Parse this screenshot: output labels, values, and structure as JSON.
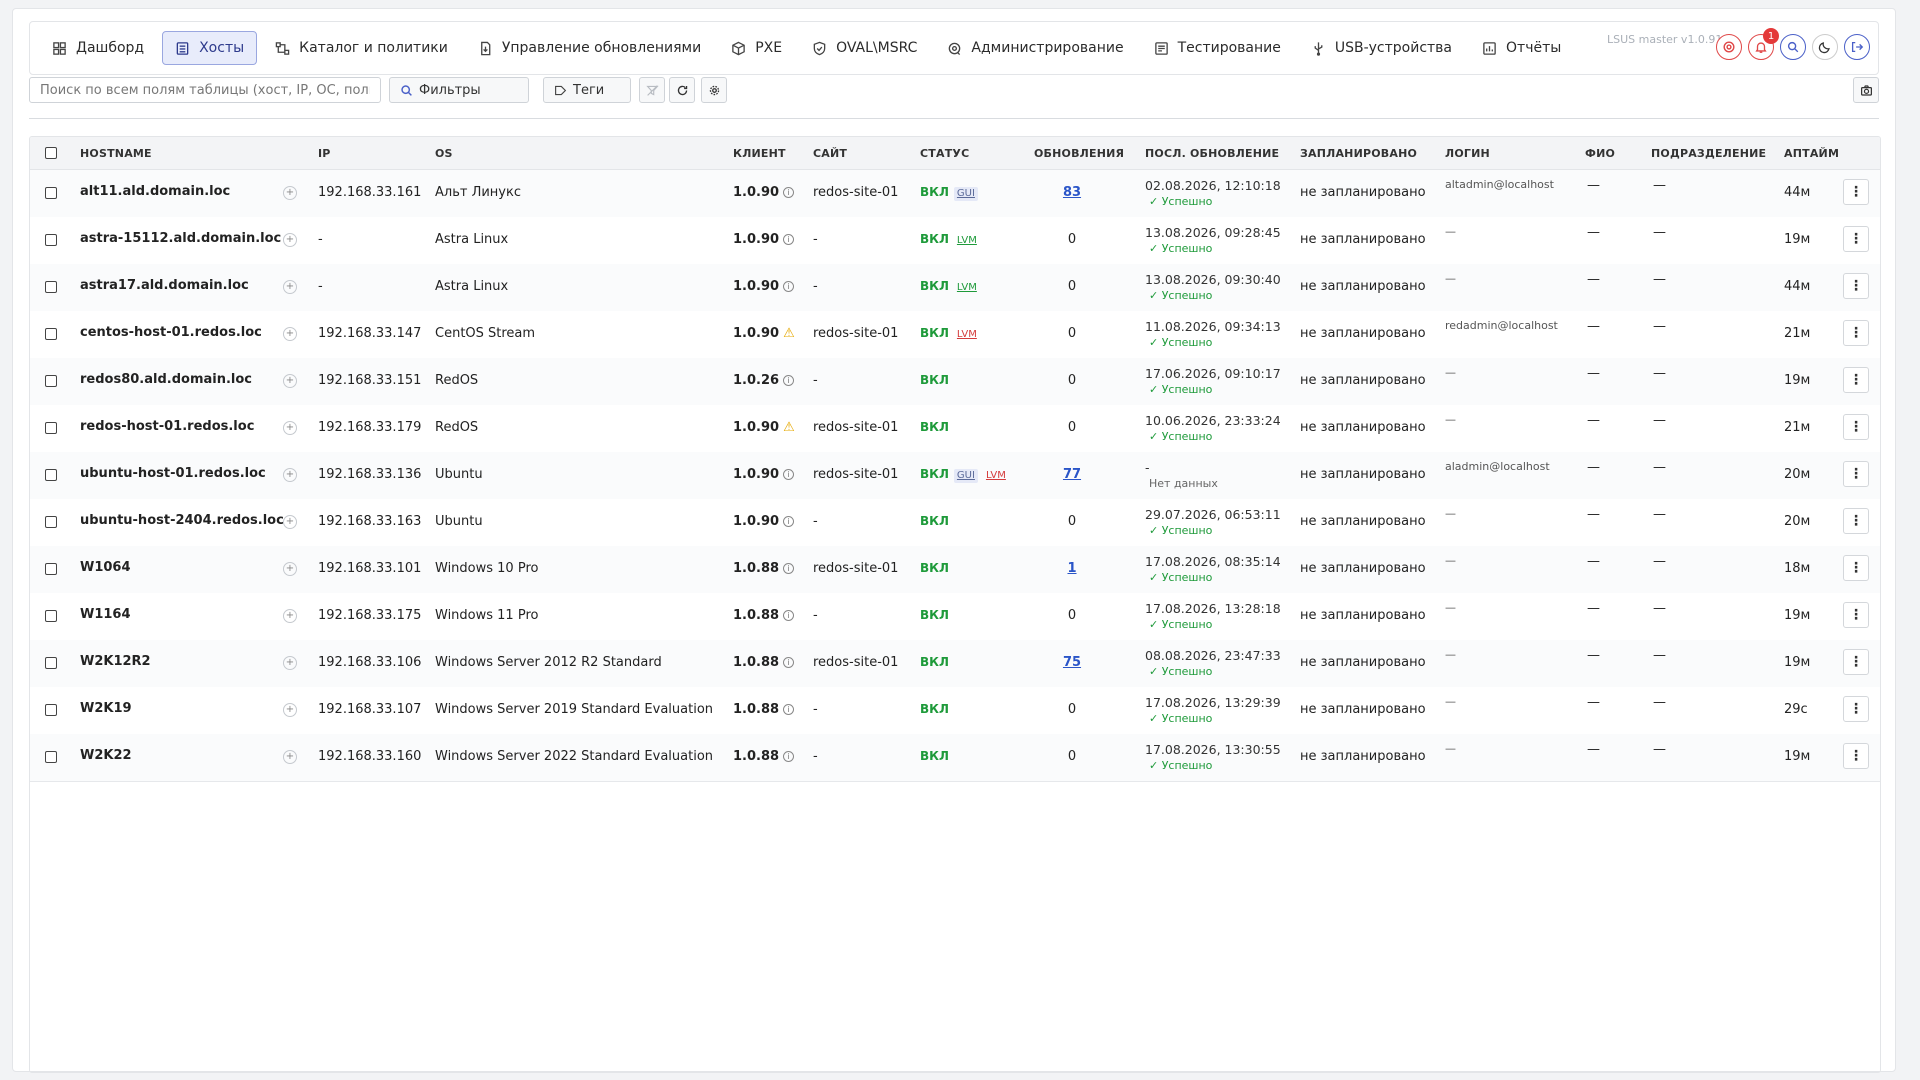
{
  "nav": {
    "items": [
      {
        "label": "Дашборд",
        "icon": "dashboard-icon",
        "active": false
      },
      {
        "label": "Хосты",
        "icon": "server-icon",
        "active": true
      },
      {
        "label": "Каталог и политики",
        "icon": "hierarchy-icon",
        "active": false
      },
      {
        "label": "Управление обновлениями",
        "icon": "file-update-icon",
        "active": false
      },
      {
        "label": "PXE",
        "icon": "cube-icon",
        "active": false
      },
      {
        "label": "OVAL\\MSRC",
        "icon": "shield-icon",
        "active": false
      },
      {
        "label": "Администрирование",
        "icon": "settings-icon",
        "active": false
      },
      {
        "label": "Тестирование",
        "icon": "checklist-icon",
        "active": false
      },
      {
        "label": "USB-устройства",
        "icon": "usb-icon",
        "active": false
      },
      {
        "label": "Отчёты",
        "icon": "report-icon",
        "active": false
      }
    ],
    "version": "LSUS master v1.0.91",
    "notifications_count": "1"
  },
  "toolbar": {
    "search_placeholder": "Поиск по всем полям таблицы (хост, IP, ОС, политика,",
    "filters_label": "Фильтры",
    "tags_label": "Теги"
  },
  "table": {
    "headers": {
      "hostname": "HOSTNAME",
      "ip": "IP",
      "os": "OS",
      "client": "КЛИЕНТ",
      "site": "САЙТ",
      "status": "СТАТУС",
      "updates": "ОБНОВЛЕНИЯ",
      "last_update": "ПОСЛ. ОБНОВЛЕНИЕ",
      "scheduled": "ЗАПЛАНИРОВАНО",
      "login": "ЛОГИН",
      "fio": "ФИО",
      "department": "ПОДРАЗДЕЛЕНИЕ",
      "uptime": "АПТАЙМ"
    },
    "rows": [
      {
        "host": "alt11.ald.domain.loc",
        "ip": "192.168.33.161",
        "os": "Альт Линукс",
        "client": "1.0.90",
        "client_icon": "info",
        "site": "redos-site-01",
        "status": "ВКЛ",
        "tags": [
          {
            "t": "GUI",
            "k": "gui"
          }
        ],
        "updates": "83",
        "updates_link": true,
        "date": "02.08.2026, 12:10:18",
        "result": "✓ Успешно",
        "scheduled": "не запланировано",
        "login": "altadmin@localhost",
        "fio": "—",
        "dept": "—",
        "uptime": "44м"
      },
      {
        "host": "astra-15112.ald.domain.loc",
        "ip": "-",
        "os": "Astra Linux",
        "client": "1.0.90",
        "client_icon": "info",
        "site": "-",
        "status": "ВКЛ",
        "tags": [
          {
            "t": "LVM",
            "k": "lvm-g"
          }
        ],
        "updates": "0",
        "updates_link": false,
        "date": "13.08.2026, 09:28:45",
        "result": "✓ Успешно",
        "scheduled": "не запланировано",
        "login": "—",
        "fio": "—",
        "dept": "—",
        "uptime": "19м"
      },
      {
        "host": "astra17.ald.domain.loc",
        "ip": "-",
        "os": "Astra Linux",
        "client": "1.0.90",
        "client_icon": "info",
        "site": "-",
        "status": "ВКЛ",
        "tags": [
          {
            "t": "LVM",
            "k": "lvm-g"
          }
        ],
        "updates": "0",
        "updates_link": false,
        "date": "13.08.2026, 09:30:40",
        "result": "✓ Успешно",
        "scheduled": "не запланировано",
        "login": "—",
        "fio": "—",
        "dept": "—",
        "uptime": "44м"
      },
      {
        "host": "centos-host-01.redos.loc",
        "ip": "192.168.33.147",
        "os": "CentOS Stream",
        "client": "1.0.90",
        "client_icon": "warn",
        "site": "redos-site-01",
        "status": "ВКЛ",
        "tags": [
          {
            "t": "LVM",
            "k": "lvm-r"
          }
        ],
        "updates": "0",
        "updates_link": false,
        "date": "11.08.2026, 09:34:13",
        "result": "✓ Успешно",
        "scheduled": "не запланировано",
        "login": "redadmin@localhost",
        "fio": "—",
        "dept": "—",
        "uptime": "21м"
      },
      {
        "host": "redos80.ald.domain.loc",
        "ip": "192.168.33.151",
        "os": "RedOS",
        "client": "1.0.26",
        "client_icon": "info",
        "site": "-",
        "status": "ВКЛ",
        "tags": [],
        "updates": "0",
        "updates_link": false,
        "date": "17.06.2026, 09:10:17",
        "result": "✓ Успешно",
        "scheduled": "не запланировано",
        "login": "—",
        "fio": "—",
        "dept": "—",
        "uptime": "19м"
      },
      {
        "host": "redos-host-01.redos.loc",
        "ip": "192.168.33.179",
        "os": "RedOS",
        "client": "1.0.90",
        "client_icon": "warn",
        "site": "redos-site-01",
        "status": "ВКЛ",
        "tags": [],
        "updates": "0",
        "updates_link": false,
        "date": "10.06.2026, 23:33:24",
        "result": "✓ Успешно",
        "scheduled": "не запланировано",
        "login": "—",
        "fio": "—",
        "dept": "—",
        "uptime": "21м"
      },
      {
        "host": "ubuntu-host-01.redos.loc",
        "ip": "192.168.33.136",
        "os": "Ubuntu",
        "client": "1.0.90",
        "client_icon": "info",
        "site": "redos-site-01",
        "status": "ВКЛ",
        "tags": [
          {
            "t": "GUI",
            "k": "gui"
          },
          {
            "t": "LVM",
            "k": "lvm-r"
          }
        ],
        "updates": "77",
        "updates_link": true,
        "date": "-",
        "result": "Нет данных",
        "scheduled": "не запланировано",
        "login": "aladmin@localhost",
        "fio": "—",
        "dept": "—",
        "uptime": "20м"
      },
      {
        "host": "ubuntu-host-2404.redos.loc",
        "ip": "192.168.33.163",
        "os": "Ubuntu",
        "client": "1.0.90",
        "client_icon": "info",
        "site": "-",
        "status": "ВКЛ",
        "tags": [],
        "updates": "0",
        "updates_link": false,
        "date": "29.07.2026, 06:53:11",
        "result": "✓ Успешно",
        "scheduled": "не запланировано",
        "login": "—",
        "fio": "—",
        "dept": "—",
        "uptime": "20м"
      },
      {
        "host": "W1064",
        "ip": "192.168.33.101",
        "os": "Windows 10 Pro",
        "client": "1.0.88",
        "client_icon": "info",
        "site": "redos-site-01",
        "status": "ВКЛ",
        "tags": [],
        "updates": "1",
        "updates_link": true,
        "date": "17.08.2026, 08:35:14",
        "result": "✓ Успешно",
        "scheduled": "не запланировано",
        "login": "—",
        "fio": "—",
        "dept": "—",
        "uptime": "18м"
      },
      {
        "host": "W1164",
        "ip": "192.168.33.175",
        "os": "Windows 11 Pro",
        "client": "1.0.88",
        "client_icon": "info",
        "site": "-",
        "status": "ВКЛ",
        "tags": [],
        "updates": "0",
        "updates_link": false,
        "date": "17.08.2026, 13:28:18",
        "result": "✓ Успешно",
        "scheduled": "не запланировано",
        "login": "—",
        "fio": "—",
        "dept": "—",
        "uptime": "19м"
      },
      {
        "host": "W2K12R2",
        "ip": "192.168.33.106",
        "os": "Windows Server 2012 R2 Standard",
        "client": "1.0.88",
        "client_icon": "info",
        "site": "redos-site-01",
        "status": "ВКЛ",
        "tags": [],
        "updates": "75",
        "updates_link": true,
        "date": "08.08.2026, 23:47:33",
        "result": "✓ Успешно",
        "scheduled": "не запланировано",
        "login": "—",
        "fio": "—",
        "dept": "—",
        "uptime": "19м"
      },
      {
        "host": "W2K19",
        "ip": "192.168.33.107",
        "os": "Windows Server 2019 Standard Evaluation",
        "client": "1.0.88",
        "client_icon": "info",
        "site": "-",
        "status": "ВКЛ",
        "tags": [],
        "updates": "0",
        "updates_link": false,
        "date": "17.08.2026, 13:29:39",
        "result": "✓ Успешно",
        "scheduled": "не запланировано",
        "login": "—",
        "fio": "—",
        "dept": "—",
        "uptime": "29с"
      },
      {
        "host": "W2K22",
        "ip": "192.168.33.160",
        "os": "Windows Server 2022 Standard Evaluation",
        "client": "1.0.88",
        "client_icon": "info",
        "site": "-",
        "status": "ВКЛ",
        "tags": [],
        "updates": "0",
        "updates_link": false,
        "date": "17.08.2026, 13:30:55",
        "result": "✓ Успешно",
        "scheduled": "не запланировано",
        "login": "—",
        "fio": "—",
        "dept": "—",
        "uptime": "19м"
      }
    ]
  }
}
